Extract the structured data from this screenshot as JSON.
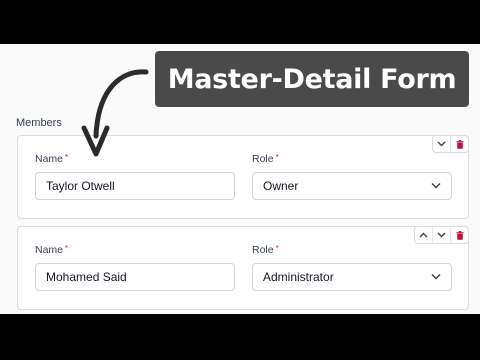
{
  "overlay": {
    "title": "Master-Detail Form"
  },
  "section": {
    "label": "Members"
  },
  "members": [
    {
      "name_label": "Name",
      "name_value": "Taylor Otwell",
      "role_label": "Role",
      "role_value": "Owner",
      "actions": [
        "chevron-down-icon",
        "trash-icon"
      ]
    },
    {
      "name_label": "Name",
      "name_value": "Mohamed Said",
      "role_label": "Role",
      "role_value": "Administrator",
      "actions": [
        "chevron-up-icon",
        "chevron-down-icon",
        "trash-icon"
      ]
    }
  ],
  "required_marker": "*",
  "colors": {
    "required": "#dc2626",
    "delete": "#be123c",
    "overlay_bg": "#4a4a4a",
    "arrow": "#2b2b2b"
  }
}
